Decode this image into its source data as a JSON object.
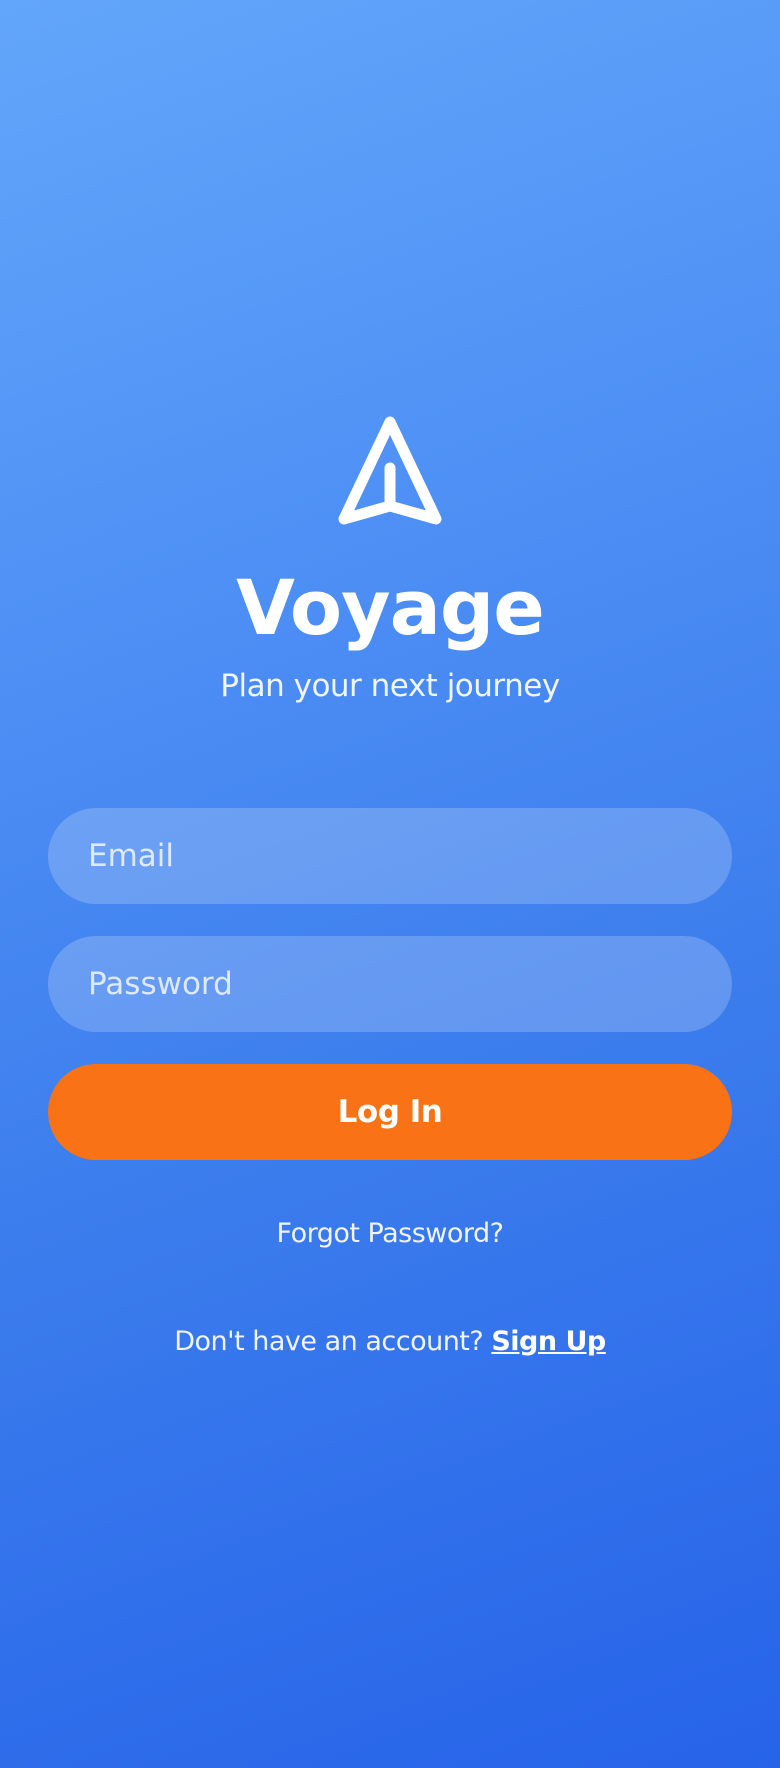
{
  "app": {
    "title": "Voyage",
    "subtitle": "Plan your next journey",
    "logo_icon": "paper-plane-icon"
  },
  "form": {
    "email_placeholder": "Email",
    "email_value": "",
    "password_placeholder": "Password",
    "password_value": "",
    "login_label": "Log In",
    "forgot_label": "Forgot Password?"
  },
  "signup": {
    "prompt": "Don't have an account?",
    "link_label": "Sign Up"
  },
  "colors": {
    "background_start": "#62a6fb",
    "background_end": "#2663e9",
    "accent": "#f97316",
    "text": "#ffffff"
  }
}
